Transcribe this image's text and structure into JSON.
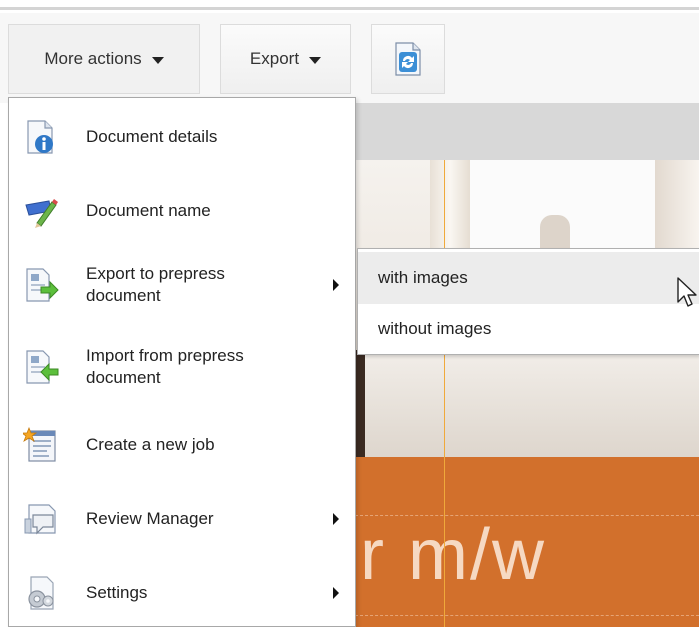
{
  "toolbar": {
    "more_actions_label": "More actions",
    "export_label": "Export",
    "refresh_icon": "refresh-document-icon"
  },
  "menu": {
    "items": [
      {
        "label": "Document details",
        "icon": "document-info-icon",
        "has_submenu": false
      },
      {
        "label": "Document name",
        "icon": "rename-pencil-icon",
        "has_submenu": false
      },
      {
        "label": "Export to prepress\ndocument",
        "icon": "export-prepress-icon",
        "has_submenu": true
      },
      {
        "label": "Import from prepress\ndocument",
        "icon": "import-prepress-icon",
        "has_submenu": false
      },
      {
        "label": "Create a new job",
        "icon": "new-job-icon",
        "has_submenu": false
      },
      {
        "label": "Review Manager",
        "icon": "review-manager-icon",
        "has_submenu": true
      },
      {
        "label": "Settings",
        "icon": "settings-gear-icon",
        "has_submenu": true
      }
    ]
  },
  "submenu": {
    "items": [
      {
        "label": "with images",
        "hover": true
      },
      {
        "label": "without images",
        "hover": false
      }
    ]
  },
  "canvas": {
    "headline_fragment": "r m/w",
    "accent_color": "#d2702c"
  }
}
